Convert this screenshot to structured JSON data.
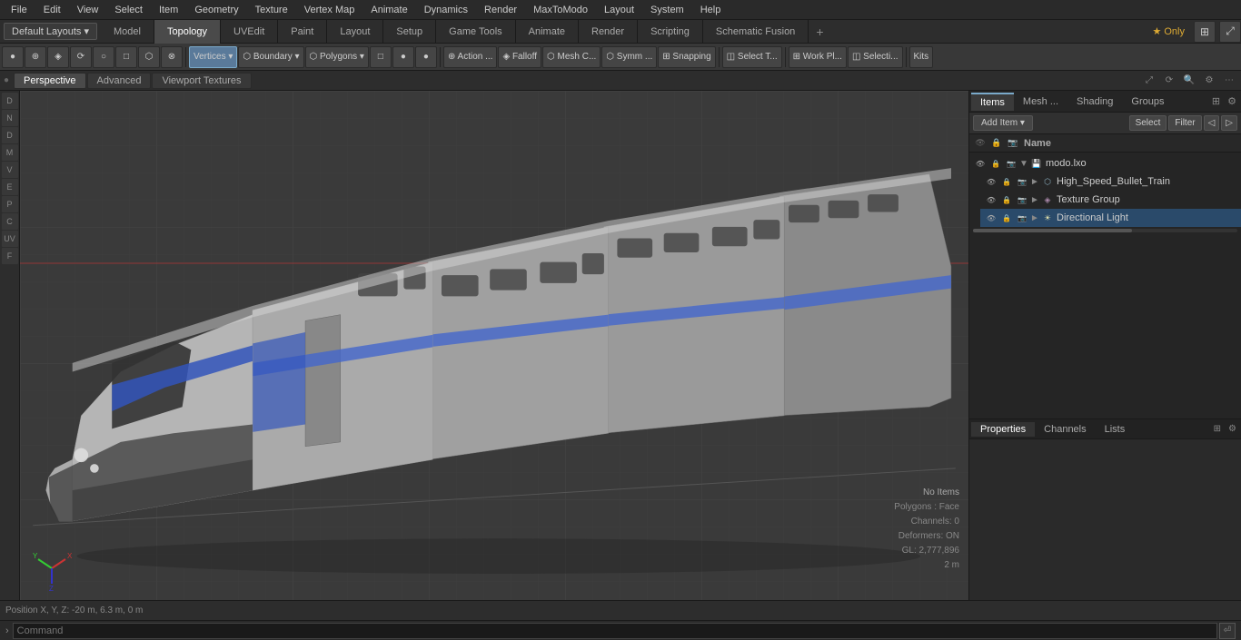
{
  "menubar": {
    "items": [
      "File",
      "Edit",
      "View",
      "Select",
      "Item",
      "Geometry",
      "Texture",
      "Vertex Map",
      "Animate",
      "Dynamics",
      "Render",
      "MaxToModo",
      "Layout",
      "System",
      "Help"
    ]
  },
  "layouts_dropdown": "Default Layouts ▾",
  "tabs": [
    {
      "label": "Model",
      "active": false
    },
    {
      "label": "Topology",
      "active": false
    },
    {
      "label": "UVEdit",
      "active": false
    },
    {
      "label": "Paint",
      "active": false
    },
    {
      "label": "Layout",
      "active": false
    },
    {
      "label": "Setup",
      "active": false
    },
    {
      "label": "Game Tools",
      "active": false
    },
    {
      "label": "Animate",
      "active": false
    },
    {
      "label": "Render",
      "active": false
    },
    {
      "label": "Scripting",
      "active": false
    },
    {
      "label": "Schematic Fusion",
      "active": false
    }
  ],
  "topright": {
    "star_label": "★ Only"
  },
  "toolbar": {
    "buttons": [
      "●",
      "⊕",
      "◈",
      "⟳",
      "○",
      "□",
      "⬡",
      "⊗",
      "Vertices ▾",
      "Boundary ▾",
      "Polygons ▾",
      "□",
      "●",
      "●",
      "Action ...",
      "Falloff",
      "Mesh C...",
      "Symm ...",
      "Snapping",
      "Select T...",
      "Work Pl...",
      "Selecti...",
      "Kits"
    ]
  },
  "viewport": {
    "tabs": [
      "Perspective",
      "Advanced",
      "Viewport Textures"
    ],
    "stats": {
      "no_items": "No Items",
      "polygons": "Polygons : Face",
      "channels": "Channels: 0",
      "deformers": "Deformers: ON",
      "gl": "GL: 2,777,896",
      "distance": "2 m"
    }
  },
  "right_panel": {
    "tabs": [
      "Items",
      "Mesh ...",
      "Shading",
      "Groups"
    ],
    "active_tab": "Items",
    "toolbar": {
      "add_item": "Add Item",
      "dropdown_arrow": "▾",
      "select": "Select",
      "filter": "Filter"
    },
    "col_header": {
      "name": "Name"
    },
    "tree": [
      {
        "id": "root",
        "label": "modo.lxo",
        "icon": "💾",
        "indent": 0,
        "expand": "▼",
        "visible": true
      },
      {
        "id": "mesh",
        "label": "High_Speed_Bullet_Train",
        "icon": "⬡",
        "indent": 1,
        "expand": "►",
        "visible": true
      },
      {
        "id": "texgrp",
        "label": "Texture Group",
        "icon": "◈",
        "indent": 1,
        "expand": "►",
        "visible": true
      },
      {
        "id": "dirlight",
        "label": "Directional Light",
        "icon": "☀",
        "indent": 1,
        "expand": "►",
        "visible": true
      }
    ]
  },
  "properties_panel": {
    "tabs": [
      "Properties",
      "Channels",
      "Lists"
    ],
    "active_tab": "Properties"
  },
  "bottombar": {
    "position": "Position X, Y, Z:  -20 m, 6.3 m, 0 m"
  },
  "commandbar": {
    "placeholder": "Command",
    "arrow": "›"
  }
}
